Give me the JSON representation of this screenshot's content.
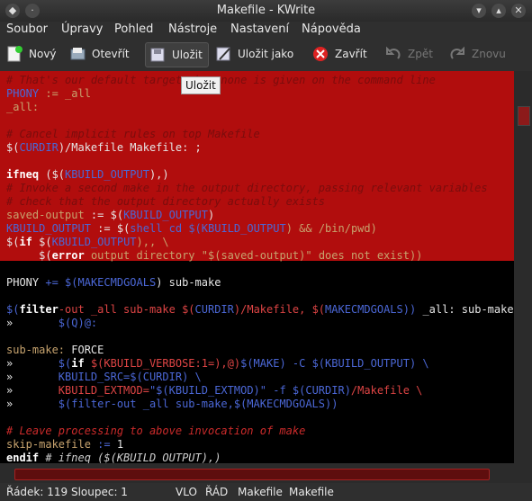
{
  "window": {
    "title": "Makefile - KWrite"
  },
  "menu": [
    "Soubor",
    "Úpravy",
    "Pohled",
    "Nástroje",
    "Nastavení",
    "Nápověda"
  ],
  "toolbar": {
    "new": "Nový",
    "open": "Otevřít",
    "save": "Uložit",
    "save_as": "Uložit jako",
    "close": "Zavřít",
    "undo": "Zpět",
    "redo": "Znovu"
  },
  "tooltip": "Uložit",
  "code": [
    {
      "segs": [
        [
          "# That's our default target w",
          "c"
        ],
        [
          "hen none is given on the command line",
          "c"
        ]
      ]
    },
    {
      "segs": [
        [
          "PHONY ",
          "v"
        ],
        [
          ":= ",
          "o"
        ],
        [
          "_all",
          "o"
        ]
      ]
    },
    {
      "segs": [
        [
          "_all:",
          "o"
        ]
      ]
    },
    {
      "segs": []
    },
    {
      "segs": [
        [
          "# Cancel implicit rules on top Makefile",
          "c"
        ]
      ]
    },
    {
      "segs": [
        [
          "$(",
          "w"
        ],
        [
          "CURDIR",
          "v"
        ],
        [
          ")/Makefile Makefile: ;",
          "w"
        ]
      ]
    },
    {
      "segs": []
    },
    {
      "segs": [
        [
          "ifneq",
          "k"
        ],
        [
          " ($(",
          "w"
        ],
        [
          "KBUILD_OUTPUT",
          "v"
        ],
        [
          "),)",
          "w"
        ]
      ]
    },
    {
      "segs": [
        [
          "# Invoke a second make in the output directory, passing relevant variables",
          "c"
        ]
      ]
    },
    {
      "segs": [
        [
          "# check that the output directory actually exists",
          "c"
        ]
      ]
    },
    {
      "segs": [
        [
          "saved-output ",
          "o"
        ],
        [
          ":= ",
          "w"
        ],
        [
          "$(",
          "w"
        ],
        [
          "KBUILD_OUTPUT",
          "v"
        ],
        [
          ")",
          "w"
        ]
      ]
    },
    {
      "segs": [
        [
          "KBUILD_OUTPUT ",
          "v"
        ],
        [
          ":= ",
          "w"
        ],
        [
          "$(",
          "w"
        ],
        [
          "shell cd $(",
          "v"
        ],
        [
          "KBUILD_OUTPUT",
          "v"
        ],
        [
          ") && /bin/pwd)",
          "o"
        ]
      ]
    },
    {
      "segs": [
        [
          "$(",
          "w"
        ],
        [
          "if ",
          "k"
        ],
        [
          "$(",
          "w"
        ],
        [
          "KBUILD_OUTPUT",
          "v"
        ],
        [
          "),, \\",
          "o"
        ]
      ]
    },
    {
      "segs": [
        [
          "     $(",
          "w"
        ],
        [
          "error ",
          "k"
        ],
        [
          "output directory \"$(",
          "o"
        ],
        [
          "saved-output",
          "o"
        ],
        [
          ")\" does not exist))",
          "o"
        ]
      ]
    },
    {
      "segs": []
    },
    {
      "segs": [
        [
          "PHONY ",
          "w"
        ],
        [
          "+= ",
          "v"
        ],
        [
          "$(",
          "v"
        ],
        [
          "MAKECMDGOALS",
          "v"
        ],
        [
          ") sub-make",
          "w"
        ]
      ]
    },
    {
      "segs": []
    },
    {
      "segs": [
        [
          "$(",
          "v"
        ],
        [
          "filter",
          "k"
        ],
        [
          "-out _all sub-make $(",
          "s"
        ],
        [
          "CURDIR",
          "v"
        ],
        [
          ")/Makefile, $(",
          "s"
        ],
        [
          "MAKECMDGOALS",
          "v"
        ],
        [
          ")) ",
          "v"
        ],
        [
          "_all: sub-make",
          "w"
        ]
      ]
    },
    {
      "segs": [
        [
          "»       ",
          "w"
        ],
        [
          "$(Q)@:",
          "v"
        ]
      ]
    },
    {
      "segs": []
    },
    {
      "segs": [
        [
          "sub-make: ",
          "o"
        ],
        [
          "FORCE",
          "w"
        ]
      ]
    },
    {
      "segs": [
        [
          "»       ",
          "w"
        ],
        [
          "$(",
          "v"
        ],
        [
          "if ",
          "k"
        ],
        [
          "$(KBUILD_VERBOSE:1=),@)",
          "s"
        ],
        [
          "$(MAKE) -C $(KBUILD_OUTPUT) \\",
          "v"
        ]
      ]
    },
    {
      "segs": [
        [
          "»       ",
          "w"
        ],
        [
          "KBUILD_SRC=$(CURDIR) \\",
          "v"
        ]
      ]
    },
    {
      "segs": [
        [
          "»       ",
          "w"
        ],
        [
          "KBUILD_EXTMOD=",
          "s"
        ],
        [
          "\"$(KBUILD_EXTMOD)\" -f $(CURDIR)",
          "v"
        ],
        [
          "/Makefile \\",
          "s"
        ]
      ]
    },
    {
      "segs": [
        [
          "»       ",
          "w"
        ],
        [
          "$(filter-out _all sub-make,$(MAKECMDGOALS))",
          "v"
        ]
      ]
    },
    {
      "segs": []
    },
    {
      "segs": [
        [
          "# Leave processing to above invocation of make",
          "cm"
        ]
      ]
    },
    {
      "segs": [
        [
          "skip-makefile ",
          "o"
        ],
        [
          ":= ",
          "v"
        ],
        [
          "1",
          "w"
        ]
      ]
    },
    {
      "segs": [
        [
          "endif",
          "k"
        ],
        [
          " # ifneq ($(KBUILD_OUTPUT),)",
          "cmw"
        ]
      ]
    }
  ],
  "status": {
    "position": "Řádek: 119 Sloupec: 1",
    "mode": "VLO",
    "line_mode": "ŘÁD",
    "filetype": "Makefile",
    "filename": "Makefile"
  }
}
